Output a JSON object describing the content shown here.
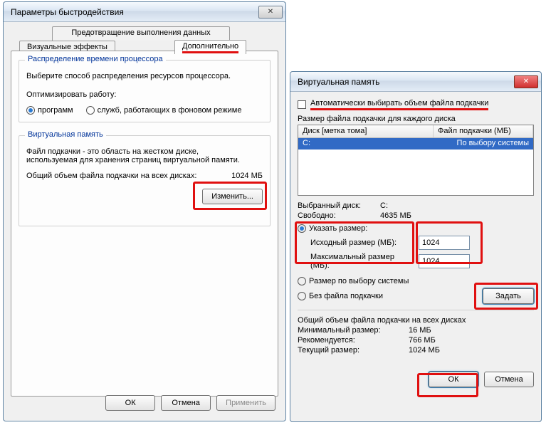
{
  "perf": {
    "title": "Параметры быстродействия",
    "tab_dep": "Предотвращение выполнения данных",
    "tab_visual": "Визуальные эффекты",
    "tab_adv": "Дополнительно",
    "cpu_group": "Распределение времени процессора",
    "cpu_desc": "Выберите способ распределения ресурсов процессора.",
    "cpu_opt": "Оптимизировать работу:",
    "opt_programs": "программ",
    "opt_services": "служб, работающих в фоновом режиме",
    "vm_group": "Виртуальная память",
    "vm_desc1": "Файл подкачки - это область на жестком диске,",
    "vm_desc2": "используемая для хранения страниц виртуальной памяти.",
    "vm_total_lbl": "Общий объем файла подкачки на всех дисках:",
    "vm_total_val": "1024 МБ",
    "btn_change": "Изменить...",
    "ok": "ОК",
    "cancel": "Отмена",
    "apply": "Применить"
  },
  "vm": {
    "title": "Виртуальная память",
    "auto_chk": "Автоматически выбирать объем файла подкачки",
    "size_each": "Размер файла подкачки для каждого диска",
    "col_disk": "Диск [метка тома]",
    "col_file": "Файл подкачки (МБ)",
    "row_drive": "C:",
    "row_val": "По выбору системы",
    "sel_disk_lbl": "Выбранный диск:",
    "sel_disk_val": "C:",
    "free_lbl": "Свободно:",
    "free_val": "4635 МБ",
    "opt_custom": "Указать размер:",
    "init_lbl": "Исходный размер (МБ):",
    "init_val": "1024",
    "max_lbl": "Максимальный размер (МБ):",
    "max_val": "1024",
    "opt_sys": "Размер по выбору системы",
    "opt_none": "Без файла подкачки",
    "btn_set": "Задать",
    "total_hdr": "Общий объем файла подкачки на всех дисках",
    "min_lbl": "Минимальный размер:",
    "min_val": "16 МБ",
    "rec_lbl": "Рекомендуется:",
    "rec_val": "766 МБ",
    "cur_lbl": "Текущий размер:",
    "cur_val": "1024 МБ",
    "ok": "ОК",
    "cancel": "Отмена"
  }
}
